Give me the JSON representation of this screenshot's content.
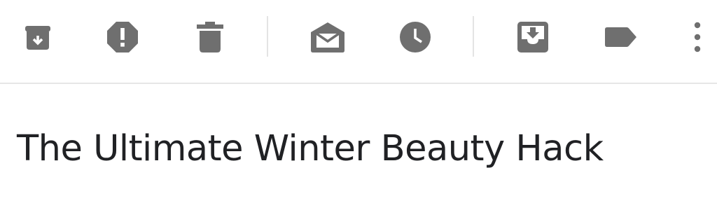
{
  "toolbar": {
    "icon_color": "#6f6f6f",
    "separator_color": "#e4e4e4",
    "actions": [
      {
        "name": "archive",
        "icon": "archive-icon"
      },
      {
        "name": "report-spam",
        "icon": "report-spam-icon"
      },
      {
        "name": "delete",
        "icon": "trash-icon"
      },
      {
        "name": "mark-unread",
        "icon": "mark-unread-envelope-icon"
      },
      {
        "name": "snooze",
        "icon": "clock-icon"
      },
      {
        "name": "move-to-inbox",
        "icon": "move-to-inbox-icon"
      },
      {
        "name": "label",
        "icon": "label-tag-icon"
      },
      {
        "name": "more-options",
        "icon": "more-vert-icon"
      }
    ]
  },
  "message": {
    "subject": "The Ultimate Winter Beauty Hack"
  }
}
